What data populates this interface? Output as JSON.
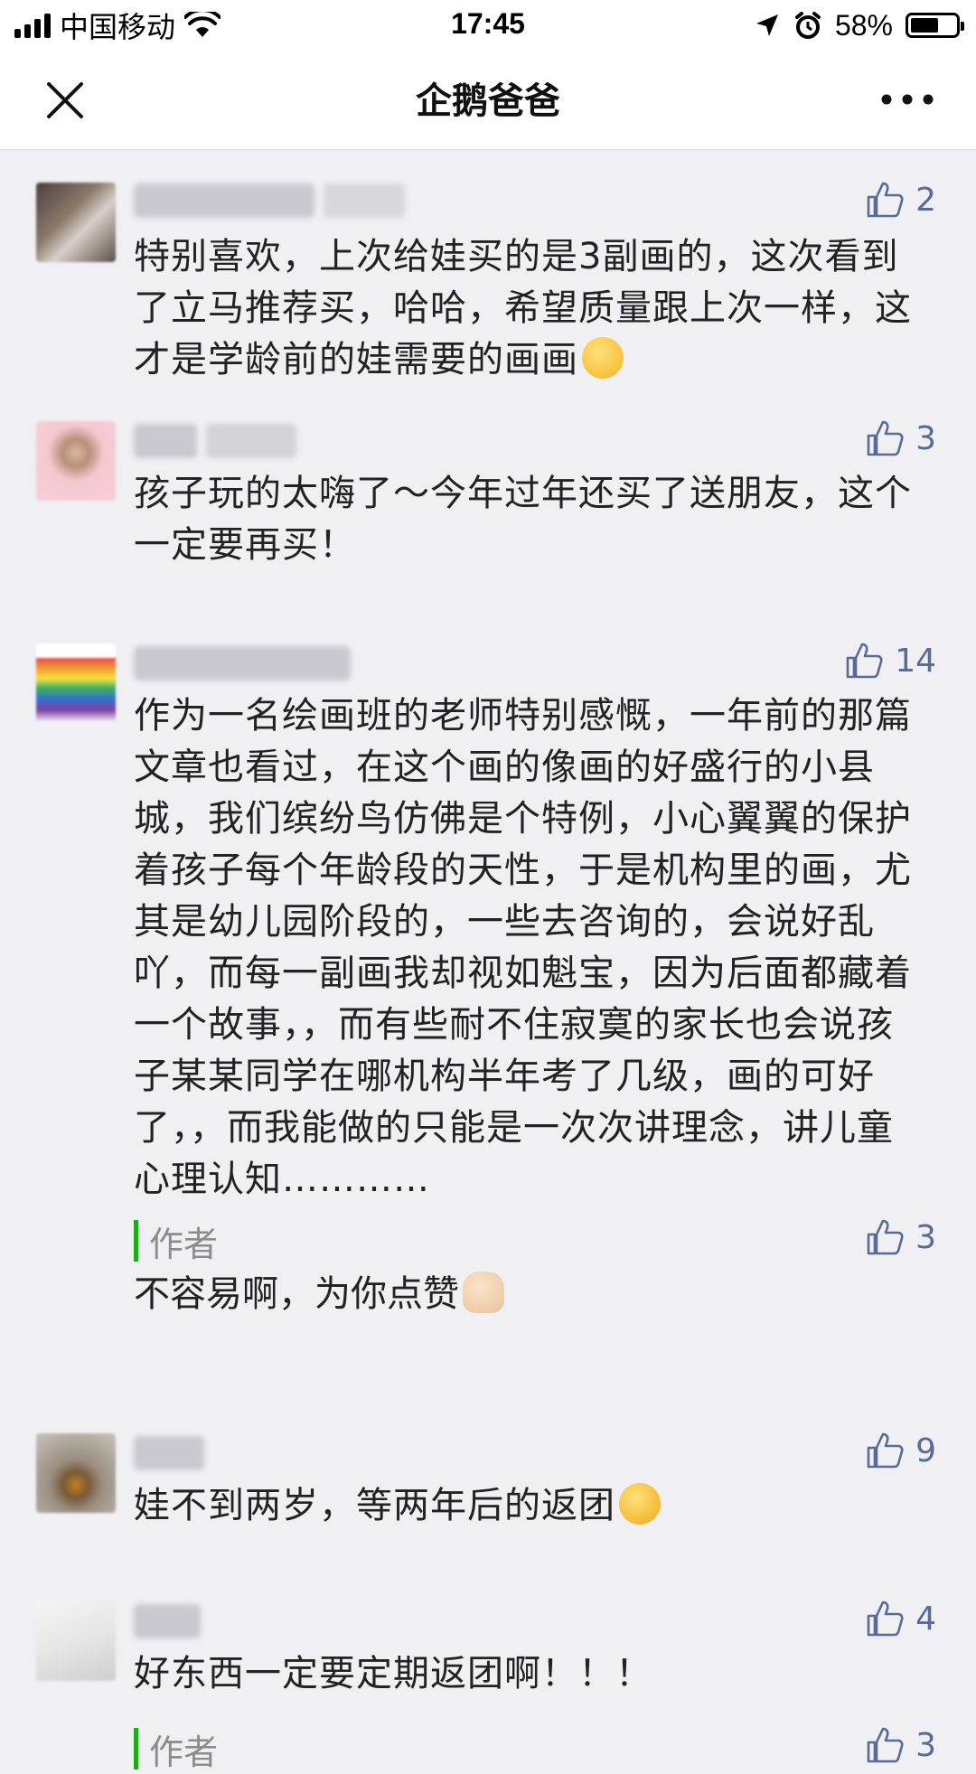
{
  "status_bar": {
    "carrier": "中国移动",
    "time": "17:45",
    "battery": "58%"
  },
  "nav": {
    "title": "企鹅爸爸"
  },
  "comments": [
    {
      "likes": "2",
      "text": "特别喜欢，上次给娃买的是3副画的，这次看到了立马推荐买，哈哈，希望质量跟上次一样，这才是学龄前的娃需要的画画",
      "emoji": "thinking-emoji"
    },
    {
      "likes": "3",
      "text": "孩子玩的太嗨了～今年过年还买了送朋友，这个一定要再买！"
    },
    {
      "likes": "14",
      "text": "作为一名绘画班的老师特别感慨，一年前的那篇文章也看过，在这个画的像画的好盛行的小县城，我们缤纷鸟仿佛是个特例，小心翼翼的保护着孩子每个年龄段的天性，于是机构里的画，尤其是幼儿园阶段的，一些去咨询的，会说好乱吖，而每一副画我却视如魁宝，因为后面都藏着一个故事，，而有些耐不住寂寞的家长也会说孩子某某同学在哪机构半年考了几级，画的可好了，，而我能做的只能是一次次讲理念，讲儿童心理认知…………",
      "author_reply": {
        "label": "作者",
        "likes": "3",
        "text": "不容易啊，为你点赞",
        "emoji": "thumbs-up-emoji"
      }
    },
    {
      "likes": "9",
      "text": "娃不到两岁，等两年后的返团",
      "emoji": "crying-laughing-emoji"
    },
    {
      "likes": "4",
      "text": "好东西一定要定期返团啊！！！",
      "author_reply": {
        "label": "作者",
        "likes": "3"
      }
    }
  ],
  "colors": {
    "link_blue": "#576b95",
    "author_green": "#1aad19",
    "background": "#efeff4"
  }
}
